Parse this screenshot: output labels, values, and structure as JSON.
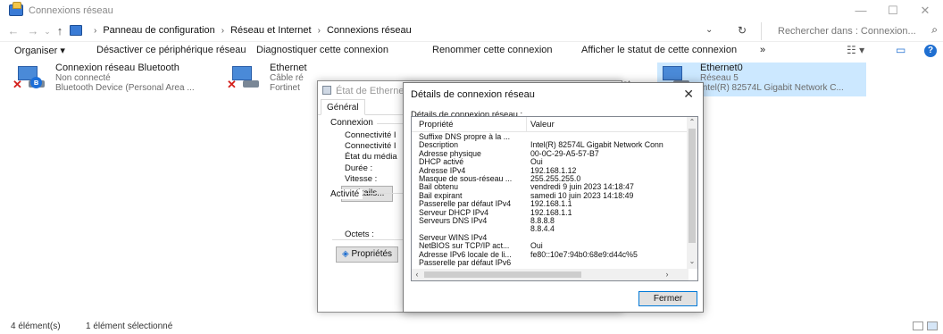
{
  "window": {
    "title": "Connexions réseau",
    "minimize_glyph": "—",
    "maximize_glyph": "☐",
    "close_glyph": "✕"
  },
  "address": {
    "back_glyph": "←",
    "forward_glyph": "→",
    "up_glyph": "↑",
    "crumbs": [
      "Panneau de configuration",
      "Réseau et Internet",
      "Connexions réseau"
    ],
    "separator": "›",
    "dropdown_glyph": "⌄",
    "refresh_glyph": "↻"
  },
  "search": {
    "placeholder": "Rechercher dans : Connexion...",
    "icon_glyph": "⌕"
  },
  "commands": {
    "organize": "Organiser ▾",
    "disable": "Désactiver ce périphérique réseau",
    "diagnose": "Diagnostiquer cette connexion",
    "rename": "Renommer cette connexion",
    "status": "Afficher le statut de cette connexion",
    "more": "»",
    "view_glyph": "☷ ▾",
    "pane_glyph": "▭",
    "help_glyph": "?"
  },
  "connections": [
    {
      "name": "Connexion réseau Bluetooth",
      "status": "Non connecté",
      "device": "Bluetooth Device (Personal Area ..."
    },
    {
      "name": "Ethernet",
      "status": "Câble ré",
      "device": "Fortinet"
    },
    {
      "name": "Ethernet0",
      "status": "Réseau 5",
      "device": "Intel(R) 82574L Gigabit Network C..."
    }
  ],
  "partial_text": {
    "behind_dialog": "net ..."
  },
  "status_dialog": {
    "title": "État de Ethernet0",
    "close_glyph": "✕",
    "tab": "Général",
    "group_connection": "Connexion",
    "rows": [
      "Connectivité I",
      "Connectivité I",
      "État du média",
      "Durée :",
      "Vitesse :"
    ],
    "details_button": "Détails...",
    "group_activity": "Activité",
    "bytes_label": "Octets :",
    "properties_button": "Propriétés"
  },
  "details_dialog": {
    "title": "Détails de connexion réseau",
    "close_glyph": "✕",
    "label": "Détails de connexion réseau :",
    "col_property": "Propriété",
    "col_value": "Valeur",
    "rows": [
      {
        "p": "Suffixe DNS propre à la ...",
        "v": ""
      },
      {
        "p": "Description",
        "v": "Intel(R) 82574L Gigabit Network Conn"
      },
      {
        "p": "Adresse physique",
        "v": "00-0C-29-A5-57-B7"
      },
      {
        "p": "DHCP activé",
        "v": "Oui"
      },
      {
        "p": "Adresse IPv4",
        "v": "192.168.1.12"
      },
      {
        "p": "Masque de sous-réseau ...",
        "v": "255.255.255.0"
      },
      {
        "p": "Bail obtenu",
        "v": "vendredi 9 juin 2023 14:18:47"
      },
      {
        "p": "Bail expirant",
        "v": "samedi 10 juin 2023 14:18:49"
      },
      {
        "p": "Passerelle par défaut IPv4",
        "v": "192.168.1.1"
      },
      {
        "p": "Serveur DHCP IPv4",
        "v": "192.168.1.1"
      },
      {
        "p": "Serveurs DNS IPv4",
        "v": "8.8.8.8"
      },
      {
        "p": "",
        "v": "8.8.4.4"
      },
      {
        "p": "Serveur WINS IPv4",
        "v": ""
      },
      {
        "p": "NetBIOS sur TCP/IP act...",
        "v": "Oui"
      },
      {
        "p": "Adresse IPv6 locale de li...",
        "v": "fe80::10e7:94b0:68e9:d44c%5"
      },
      {
        "p": "Passerelle par défaut IPv6",
        "v": ""
      }
    ],
    "close_button": "Fermer"
  },
  "statusbar": {
    "count": "4 élément(s)",
    "selection": "1 élément sélectionné"
  }
}
